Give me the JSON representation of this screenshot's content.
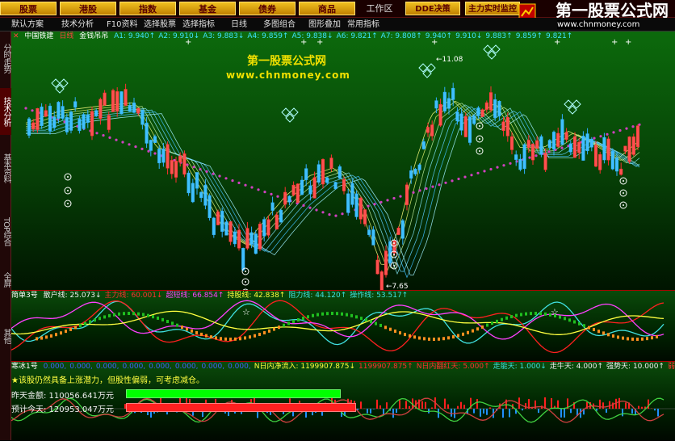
{
  "nav": {
    "items": [
      "股票",
      "港股",
      "指数",
      "基金",
      "债券",
      "商品",
      "DDE决策",
      "主力实时监控"
    ],
    "workspace": "工作区"
  },
  "logo": {
    "title": "第一股票公式网",
    "url": "www.chnmoney.com"
  },
  "toolbar": {
    "items": [
      "默认方案",
      "技术分析",
      "F10资料",
      "选择股票",
      "选择指标",
      "日线",
      "多图组合",
      "图形叠加",
      "常用指标"
    ]
  },
  "sidebar": {
    "tabs": [
      "分时走势",
      "技术分析",
      "基本资料",
      "TOP综合",
      "全屏",
      "其他"
    ],
    "active": 1
  },
  "stock": {
    "name": "中国铁建",
    "period": "日线",
    "indicator": "金钱吊吊",
    "params": [
      {
        "label": "A1: 9.940",
        "arrow": "↑"
      },
      {
        "label": "A2: 9.910",
        "arrow": "↓"
      },
      {
        "label": "A3: 9.883",
        "arrow": "↓"
      },
      {
        "label": "A4: 9.859",
        "arrow": "↑"
      },
      {
        "label": "A5: 9.838",
        "arrow": "↓"
      },
      {
        "label": "A6: 9.821",
        "arrow": "↑"
      },
      {
        "label": "A7: 9.808",
        "arrow": "↑"
      },
      {
        "label": "9.940",
        "arrow": "↑"
      },
      {
        "label": "9.910",
        "arrow": "↓"
      },
      {
        "label": "9.883",
        "arrow": "↑"
      },
      {
        "label": "9.859",
        "arrow": "↑"
      },
      {
        "label": "9.821",
        "arrow": "↑"
      }
    ]
  },
  "watermark": {
    "line1": "第一股票公式网",
    "line2": "www.chnmoney.com"
  },
  "price_annotations": {
    "high": "←11.08",
    "low": "←7.65"
  },
  "indicator2": {
    "name": "简单3号",
    "items": [
      {
        "label": "散户线: 25.073",
        "arrow": "↓",
        "color": "#f0f0f0"
      },
      {
        "label": "主力线: 60.001",
        "arrow": "↓",
        "color": "#ff3030"
      },
      {
        "label": "超短线: 66.854",
        "arrow": "↑",
        "color": "#ff40ff"
      },
      {
        "label": "持股线: 42.838",
        "arrow": "↑",
        "color": "#ffff40"
      },
      {
        "label": "阻力线: 44.120",
        "arrow": "↑",
        "color": "#40e0e0"
      },
      {
        "label": "操作线: 53.517",
        "arrow": "↑",
        "color": "#40e0e0"
      }
    ]
  },
  "indicator3": {
    "name": "寒冰1号",
    "items": [
      {
        "label": "0.000,",
        "color": "#4060ff"
      },
      {
        "label": "0.000,",
        "color": "#4060ff"
      },
      {
        "label": "0.000,",
        "color": "#4060ff"
      },
      {
        "label": "0.000,",
        "color": "#4060ff"
      },
      {
        "label": "0.000,",
        "color": "#4060ff"
      },
      {
        "label": "0.000,",
        "color": "#4060ff"
      },
      {
        "label": "0.000,",
        "color": "#4060ff"
      },
      {
        "label": "0.000,",
        "color": "#4060ff"
      },
      {
        "label": "N日内净流入: 1199907.875↓",
        "color": "#ffff40"
      },
      {
        "label": "1199907.875↑",
        "color": "#ff3030"
      },
      {
        "label": "N日内翻红天: 5.000↑",
        "color": "#ff3030"
      },
      {
        "label": "走能天: 1.000↓",
        "color": "#40e0e0"
      },
      {
        "label": "走牛天: 4.000↑",
        "color": "#f0f0f0"
      },
      {
        "label": "强势天: 10.000↑",
        "color": "#f0f0f0"
      },
      {
        "label": "弱势",
        "color": "#ff3030"
      }
    ],
    "message": "★该股仍然具备上涨潜力，但股性偏弱，可考虑减仓。",
    "yesterday_label": "昨天金额: 110056.641万元",
    "today_label": "预计今天: 120953.047万元",
    "yesterday_ratio": 0.72,
    "today_ratio": 0.77
  },
  "colors": {
    "bg_top": "#0a5a0a",
    "bg_bottom": "#001a00",
    "candle_up": "#ff3030",
    "candle_down": "#30b0ff",
    "ma_yellow": "#ffff60",
    "ma_cyan": "#40e0ff",
    "dots_purple": "#d040c0"
  }
}
